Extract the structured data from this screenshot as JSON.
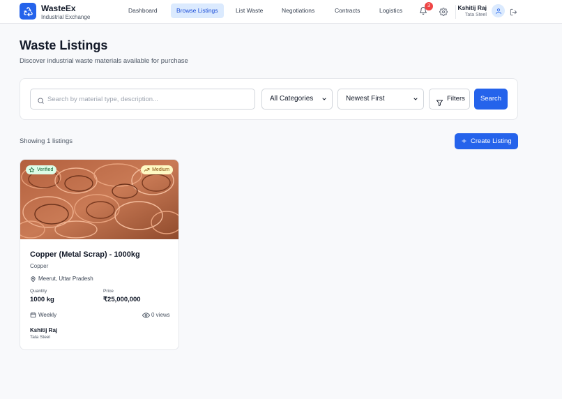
{
  "brand": {
    "name": "WasteEx",
    "subtitle": "Industrial Exchange"
  },
  "nav": {
    "items": [
      "Dashboard",
      "Browse Listings",
      "List Waste",
      "Negotiations",
      "Contracts",
      "Logistics"
    ],
    "active": "Browse Listings"
  },
  "header": {
    "notification_count": "3",
    "user_name": "Kshitij Raj",
    "user_company": "Tata Steel"
  },
  "page": {
    "title": "Waste Listings",
    "subtitle": "Discover industrial waste materials available for purchase"
  },
  "search": {
    "placeholder": "Search by material type, description...",
    "value": "",
    "category_selected": "All Categories",
    "sort_selected": "Newest First",
    "filters_label": "Filters",
    "search_label": "Search"
  },
  "results": {
    "showing_text": "Showing 1 listings",
    "create_label": "Create Listing"
  },
  "listings": [
    {
      "badge_verified": "Verified",
      "badge_grade": "Medium",
      "title": "Copper (Metal Scrap) - 1000kg",
      "material": "Copper",
      "location": "Meerut, Uttar Pradesh",
      "quantity_label": "Quantity",
      "quantity": "1000 kg",
      "price_label": "Price",
      "price": "₹25,000,000",
      "frequency": "Weekly",
      "views": "0 views",
      "seller_name": "Kshitij Raj",
      "seller_company": "Tata Steel"
    }
  ],
  "colors": {
    "primary": "#2563eb",
    "active_nav_bg": "#dbeafe",
    "badge_red": "#ef4444",
    "verified_bg": "#dcfce7",
    "medium_bg": "#fef9c3",
    "copper": "#c2704a"
  },
  "icons": {
    "logo": "recycle-icon",
    "notifications": "bell-icon",
    "settings": "gear-icon",
    "user": "user-icon",
    "logout": "logout-icon",
    "search": "search-icon",
    "filters": "filter-icon",
    "create": "plus-icon",
    "location": "map-pin-icon",
    "frequency": "calendar-icon",
    "views": "eye-icon"
  }
}
